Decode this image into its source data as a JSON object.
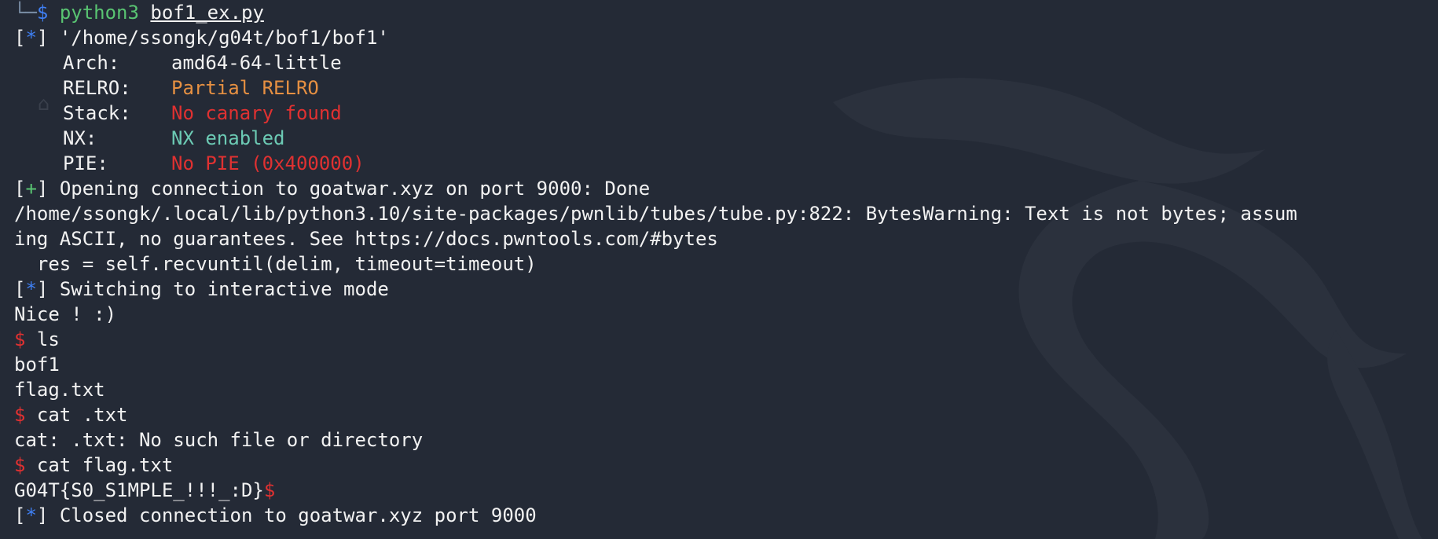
{
  "prompt": {
    "corner": "└─",
    "symbol": "$",
    "command": "python3",
    "arg": "bof1_ex.py"
  },
  "checksec": {
    "path_marker": "*",
    "path": "'/home/ssongk/g04t/bof1/bof1'",
    "rows": [
      {
        "label": "Arch:",
        "value": "amd64-64-little",
        "color": "#f2f2f2"
      },
      {
        "label": "RELRO:",
        "value": "Partial RELRO",
        "color": "#e69042"
      },
      {
        "label": "Stack:",
        "value": "No canary found",
        "color": "#e03131"
      },
      {
        "label": "NX:",
        "value": "NX enabled",
        "color": "#6ccab4"
      },
      {
        "label": "PIE:",
        "value": "No PIE (0x400000)",
        "color": "#e03131"
      }
    ]
  },
  "output": {
    "connect_marker": "+",
    "connect": "Opening connection to goatwar.xyz on port 9000: Done",
    "warning_1": "/home/ssongk/.local/lib/python3.10/site-packages/pwnlib/tubes/tube.py:822: BytesWarning: Text is not bytes; assum",
    "warning_2": "ing ASCII, no guarantees. See https://docs.pwntools.com/#bytes",
    "warning_3": "  res = self.recvuntil(delim, timeout=timeout)",
    "interactive_marker": "*",
    "interactive": "Switching to interactive mode",
    "nice": "Nice ! :)",
    "shell_symbol": "$",
    "cmd_ls": "ls",
    "ls_1": "bof1",
    "ls_2": "flag.txt",
    "cmd_cat1": "cat .txt",
    "cat_error": "cat: .txt: No such file or directory",
    "cmd_cat2": "cat flag.txt",
    "flag": "G04T{S0_S1MPLE_!!!_:D}",
    "closed_marker": "*",
    "closed": "Closed connection to goatwar.xyz port 9000"
  },
  "colors": {
    "background": "#242a36",
    "foreground": "#f2f2f2",
    "info_marker": "#3f7ff2",
    "success_marker": "#59c472",
    "shell_prompt": "#e03131"
  }
}
